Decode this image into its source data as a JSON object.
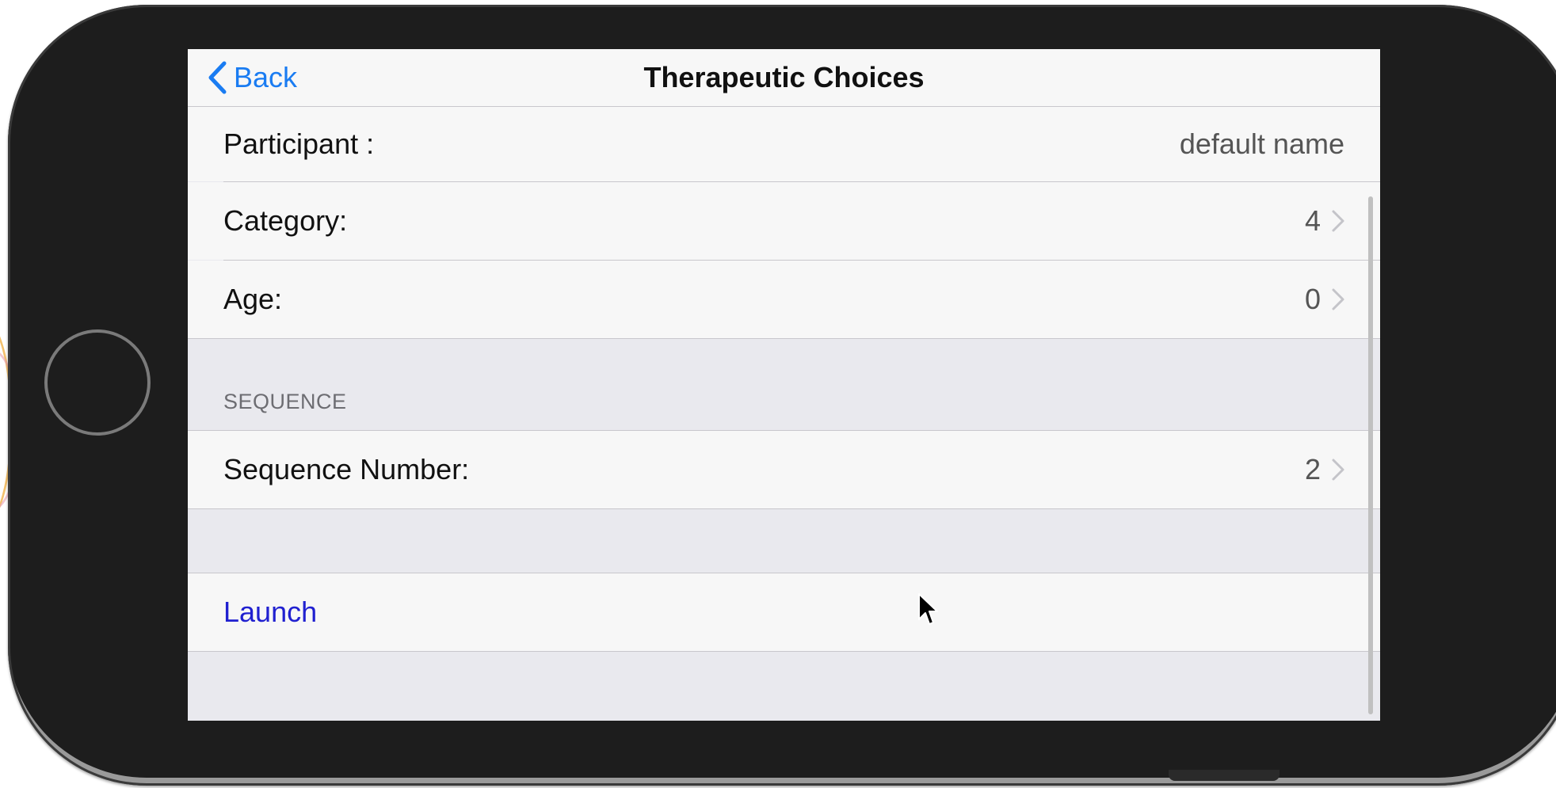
{
  "navbar": {
    "back_label": "Back",
    "title": "Therapeutic Choices"
  },
  "rows": {
    "participant": {
      "label": "Participant :",
      "value": "default name"
    },
    "category": {
      "label": "Category:",
      "value": "4"
    },
    "age": {
      "label": "Age:",
      "value": "0"
    }
  },
  "sequence_section": {
    "header": "SEQUENCE",
    "sequence_number": {
      "label": "Sequence Number:",
      "value": "2"
    }
  },
  "launch": {
    "label": "Launch"
  },
  "icons": {
    "back": "chevron-left-icon",
    "disclosure": "chevron-right-icon",
    "cursor": "mouse-pointer-icon"
  },
  "colors": {
    "accent": "#1a7cf2",
    "launch": "#2020d0",
    "device_body": "#1d1d1d",
    "grouped_background": "#e9e9ee",
    "cell_background": "#f7f7f7"
  }
}
